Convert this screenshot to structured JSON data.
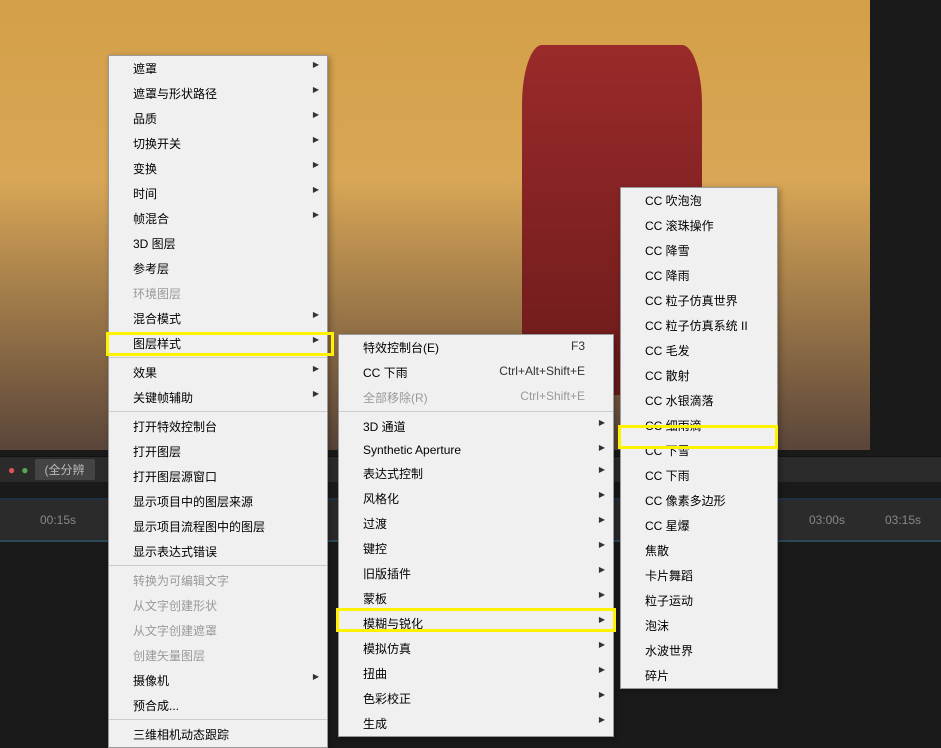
{
  "toolbar": {
    "zoom_label": "(全分辨"
  },
  "timeline": {
    "t1": "00:15s",
    "t2": "03:00s",
    "t3": "03:15s"
  },
  "menu1": [
    {
      "label": "遮罩",
      "sub": true,
      "sep": false
    },
    {
      "label": "遮罩与形状路径",
      "sub": true,
      "sep": false
    },
    {
      "label": "品质",
      "sub": true,
      "sep": false
    },
    {
      "label": "切换开关",
      "sub": true,
      "sep": false
    },
    {
      "label": "变换",
      "sub": true,
      "sep": false
    },
    {
      "label": "时间",
      "sub": true,
      "sep": false
    },
    {
      "label": "帧混合",
      "sub": true,
      "sep": false
    },
    {
      "label": "3D 图层",
      "sub": false,
      "sep": false
    },
    {
      "label": "参考层",
      "sub": false,
      "sep": false
    },
    {
      "label": "环境图层",
      "sub": false,
      "disabled": true,
      "sep": false
    },
    {
      "label": "混合模式",
      "sub": true,
      "sep": false
    },
    {
      "label": "图层样式",
      "sub": true,
      "sep": true
    },
    {
      "label": "效果",
      "sub": true,
      "sep": false
    },
    {
      "label": "关键帧辅助",
      "sub": true,
      "sep": true
    },
    {
      "label": "打开特效控制台",
      "sub": false,
      "sep": false
    },
    {
      "label": "打开图层",
      "sub": false,
      "sep": false
    },
    {
      "label": "打开图层源窗口",
      "sub": false,
      "sep": false
    },
    {
      "label": "显示项目中的图层来源",
      "sub": false,
      "sep": false
    },
    {
      "label": "显示项目流程图中的图层",
      "sub": false,
      "sep": false
    },
    {
      "label": "显示表达式错误",
      "sub": false,
      "sep": true
    },
    {
      "label": "转换为可编辑文字",
      "sub": false,
      "disabled": true,
      "sep": false
    },
    {
      "label": "从文字创建形状",
      "sub": false,
      "disabled": true,
      "sep": false
    },
    {
      "label": "从文字创建遮罩",
      "sub": false,
      "disabled": true,
      "sep": false
    },
    {
      "label": "创建矢量图层",
      "sub": false,
      "disabled": true,
      "sep": false
    },
    {
      "label": "摄像机",
      "sub": true,
      "sep": false
    },
    {
      "label": "预合成...",
      "sub": false,
      "sep": true
    },
    {
      "label": "三维相机动态跟踪",
      "sub": false,
      "sep": false
    }
  ],
  "menu2": [
    {
      "label": "特效控制台(E)",
      "shortcut": "F3",
      "sep": false
    },
    {
      "label": "CC 下雨",
      "shortcut": "Ctrl+Alt+Shift+E",
      "sep": false
    },
    {
      "label": "全部移除(R)",
      "shortcut": "Ctrl+Shift+E",
      "disabled": true,
      "sep": true
    },
    {
      "label": "3D 通道",
      "sub": true,
      "sep": false
    },
    {
      "label": "Synthetic Aperture",
      "sub": true,
      "sep": false
    },
    {
      "label": "表达式控制",
      "sub": true,
      "sep": false
    },
    {
      "label": "风格化",
      "sub": true,
      "sep": false
    },
    {
      "label": "过渡",
      "sub": true,
      "sep": false
    },
    {
      "label": "键控",
      "sub": true,
      "sep": false
    },
    {
      "label": "旧版插件",
      "sub": true,
      "sep": false
    },
    {
      "label": "蒙板",
      "sub": true,
      "sep": false
    },
    {
      "label": "模糊与锐化",
      "sub": true,
      "sep": false
    },
    {
      "label": "模拟仿真",
      "sub": true,
      "sep": false
    },
    {
      "label": "扭曲",
      "sub": true,
      "sep": false
    },
    {
      "label": "色彩校正",
      "sub": true,
      "sep": false
    },
    {
      "label": "生成",
      "sub": true,
      "sep": false
    }
  ],
  "menu3": [
    {
      "label": "CC 吹泡泡"
    },
    {
      "label": "CC 滚珠操作"
    },
    {
      "label": "CC 降雪"
    },
    {
      "label": "CC 降雨"
    },
    {
      "label": "CC 粒子仿真世界"
    },
    {
      "label": "CC 粒子仿真系统 II"
    },
    {
      "label": "CC 毛发"
    },
    {
      "label": "CC 散射"
    },
    {
      "label": "CC 水银滴落"
    },
    {
      "label": "CC 细雨滴"
    },
    {
      "label": "CC 下雪"
    },
    {
      "label": "CC 下雨"
    },
    {
      "label": "CC 像素多边形"
    },
    {
      "label": "CC 星爆"
    },
    {
      "label": "焦散"
    },
    {
      "label": "卡片舞蹈"
    },
    {
      "label": "粒子运动"
    },
    {
      "label": "泡沫"
    },
    {
      "label": "水波世界"
    },
    {
      "label": "碎片"
    }
  ]
}
